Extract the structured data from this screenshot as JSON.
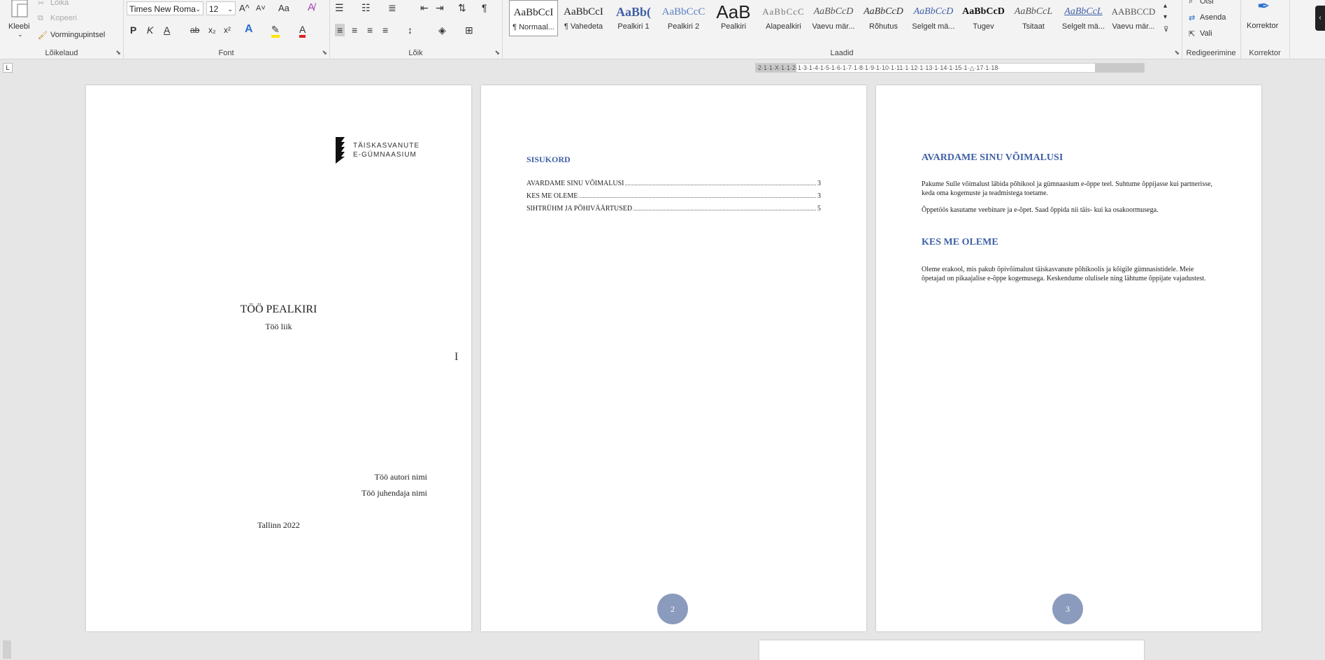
{
  "ribbon": {
    "clipboard": {
      "paste": "Kleebi",
      "cut": "Lõika",
      "copy": "Kopeeri",
      "format_painter": "Vormingupintsel",
      "label": "Lõikelaud"
    },
    "font": {
      "family": "Times New Roma",
      "size": "12",
      "bold": "P",
      "italic": "K",
      "underline": "A",
      "strike": "ab",
      "subscript": "x₂",
      "superscript": "x²",
      "grow": "A^",
      "shrink": "A˅",
      "change_case": "Aa",
      "label": "Font"
    },
    "paragraph": {
      "label": "Lõik"
    },
    "styles": {
      "label": "Laadid",
      "items": [
        {
          "sample": "AaBbCcI",
          "name": "¶ Normaal..."
        },
        {
          "sample": "AaBbCcI",
          "name": "¶ Vahedeta"
        },
        {
          "sample": "AaBb(",
          "name": "Pealkiri 1"
        },
        {
          "sample": "AaBbCcC",
          "name": "Pealkiri 2"
        },
        {
          "sample": "AaB",
          "name": "Pealkiri"
        },
        {
          "sample": "AaBbCcC",
          "name": "Alapealkiri"
        },
        {
          "sample": "AaBbCcD",
          "name": "Vaevu mär..."
        },
        {
          "sample": "AaBbCcD",
          "name": "Rõhutus"
        },
        {
          "sample": "AaBbCcD",
          "name": "Selgelt mä..."
        },
        {
          "sample": "AaBbCcD",
          "name": "Tugev"
        },
        {
          "sample": "AaBbCcL",
          "name": "Tsitaat"
        },
        {
          "sample": "AaBbCcL",
          "name": "Selgelt mä..."
        },
        {
          "sample": "AABBCCD",
          "name": "Vaevu mär..."
        }
      ]
    },
    "editing": {
      "find": "Otsi",
      "replace": "Asenda",
      "select": "Vali",
      "label": "Redigeerimine"
    },
    "proofing": {
      "button": "Korrektor",
      "label": "Korrektor"
    }
  },
  "ruler": {
    "text": "·2·1·1·X·1·1·2·1·3·1·4·1·5·1·6·1·7·1·8·1·9·1·10·1·11·1·12·1·13·1·14·1·15·1·△·17·1·18·"
  },
  "page1": {
    "logo_line1": "TÄISKASVANUTE",
    "logo_line2": "E-GÜMNAASIUM",
    "title": "TÖÖ PEALKIRI",
    "subtitle": "Töö liik",
    "author": "Töö autori nimi",
    "supervisor": "Töö juhendaja nimi",
    "place_year": "Tallinn 2022"
  },
  "page2": {
    "toc_heading": "SISUKORD",
    "toc": [
      {
        "title": "AVARDAME SINU VÕIMALUSI",
        "page": "3"
      },
      {
        "title": "KES ME OLEME",
        "page": "3"
      },
      {
        "title": "SIHTRÜHM JA PÕHIVÄÄRTUSED",
        "page": "5"
      }
    ],
    "page_number": "2"
  },
  "page3": {
    "heading1": "AVARDAME SINU VÕIMALUSI",
    "para1": "Pakume Sulle võimalust läbida põhikool ja gümnaasium e-õppe teel. Suhtume õppijasse kui partnerisse, keda oma kogemuste ja teadmistega toetame.",
    "para2": "Õppetöös kasutame veebinare ja e-õpet. Saad õppida nii täis- kui ka osakoormusega.",
    "heading2": "KES ME OLEME",
    "para3": "Oleme erakool, mis pakub õpivõimalust täiskasvanute põhikoolis ja kõigile gümnasistidele. Meie õpetajad on pikaajalise e-õppe kogemusega. Keskendume olulisele ning lähtume õppijate vajadustest.",
    "page_number": "3"
  },
  "colors": {
    "heading_blue": "#3f60a6",
    "page_badge": "#8a9bbd",
    "canvas": "#e6e6e6"
  }
}
